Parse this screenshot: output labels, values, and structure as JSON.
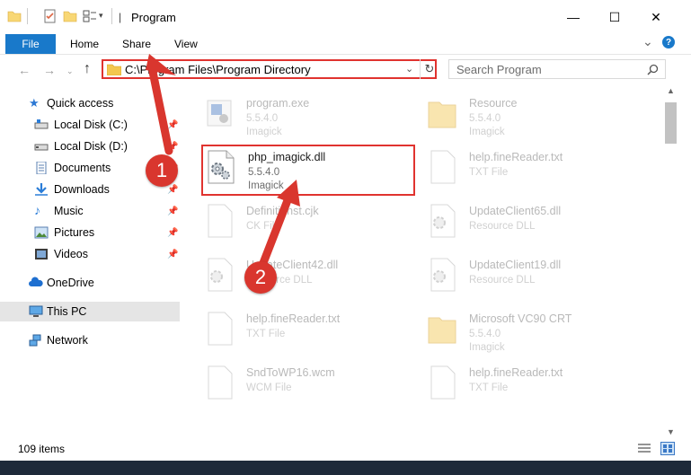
{
  "window": {
    "title": "Program",
    "minimize": "—",
    "maximize": "☐",
    "close": "✕"
  },
  "ribbon": {
    "file": "File",
    "tabs": [
      "Home",
      "Share",
      "View"
    ],
    "collapse": "⌄",
    "help": "?"
  },
  "address": {
    "path": "C:\\Program Files\\Program Directory",
    "search_placeholder": "Search Program"
  },
  "nav": {
    "items": [
      {
        "label": "Quick access",
        "icon": "star-icon",
        "pinned": false
      },
      {
        "label": "Local Disk (C:)",
        "icon": "drive-icon",
        "pinned": true
      },
      {
        "label": "Local Disk (D:)",
        "icon": "drive-icon",
        "pinned": true
      },
      {
        "label": "Documents",
        "icon": "documents-icon",
        "pinned": true
      },
      {
        "label": "Downloads",
        "icon": "download-icon",
        "pinned": true
      },
      {
        "label": "Music",
        "icon": "music-icon",
        "pinned": true
      },
      {
        "label": "Pictures",
        "icon": "pictures-icon",
        "pinned": true
      },
      {
        "label": "Videos",
        "icon": "videos-icon",
        "pinned": true
      },
      {
        "label": "OneDrive",
        "icon": "cloud-icon",
        "pinned": false
      },
      {
        "label": "This PC",
        "icon": "computer-icon",
        "pinned": false
      },
      {
        "label": "Network",
        "icon": "network-icon",
        "pinned": false
      }
    ]
  },
  "files": {
    "left": [
      {
        "name": "program.exe",
        "line2": "5.5.4.0",
        "line3": "Imagick",
        "type": "exe"
      },
      {
        "name": "php_imagick.dll",
        "line2": "5.5.4.0",
        "line3": "Imagick",
        "type": "dll"
      },
      {
        "name": "Definitionst.cjk",
        "line2": "CK File",
        "line3": "",
        "type": "doc"
      },
      {
        "name": "UpdateClient42.dll",
        "line2": "Resource DLL",
        "line3": "",
        "type": "dll"
      },
      {
        "name": "help.fineReader.txt",
        "line2": "TXT File",
        "line3": "",
        "type": "doc"
      },
      {
        "name": "SndToWP16.wcm",
        "line2": "WCM File",
        "line3": "",
        "type": "doc"
      }
    ],
    "right": [
      {
        "name": "Resource",
        "line2": "5.5.4.0",
        "line3": "Imagick",
        "type": "folder"
      },
      {
        "name": "help.fineReader.txt",
        "line2": "TXT File",
        "line3": "",
        "type": "doc"
      },
      {
        "name": "UpdateClient65.dll",
        "line2": "Resource DLL",
        "line3": "",
        "type": "dll"
      },
      {
        "name": "UpdateClient19.dll",
        "line2": "Resource DLL",
        "line3": "",
        "type": "dll"
      },
      {
        "name": "Microsoft VC90 CRT",
        "line2": "5.5.4.0",
        "line3": "Imagick",
        "type": "folder"
      },
      {
        "name": "help.fineReader.txt",
        "line2": "TXT File",
        "line3": "",
        "type": "doc"
      }
    ]
  },
  "status": {
    "items": "109 items"
  },
  "annotations": [
    "1",
    "2"
  ],
  "colors": {
    "accent": "#1979ca",
    "highlight": "#e0332f",
    "badge": "#d9362e"
  }
}
